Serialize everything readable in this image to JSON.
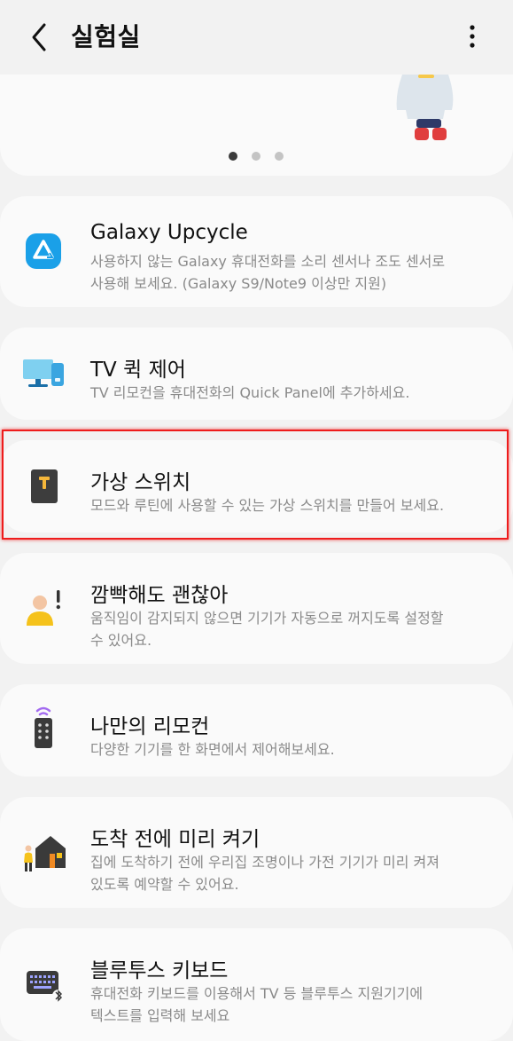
{
  "header": {
    "title": "실험실",
    "back_icon": "back-arrow-icon",
    "more_icon": "more-vertical-icon"
  },
  "banner": {
    "pager_active_index": 0,
    "pager_count": 3
  },
  "cards": [
    {
      "title": "Galaxy Upcycle",
      "desc": "사용하지 않는 Galaxy 휴대전화를 소리 센서나 조도 센서로\n사용해 보세요. (Galaxy S9/Note9 이상만 지원)",
      "icon": "upcycle-icon"
    },
    {
      "title": "TV 퀵 제어",
      "desc": "TV 리모컨을 휴대전화의 Quick Panel에 추가하세요.",
      "icon": "tv-icon"
    },
    {
      "title": "가상 스위치",
      "desc": "모드와 루틴에 사용할 수 있는 가상 스위치를 만들어 보세요.",
      "icon": "virtual-switch-icon"
    },
    {
      "title": "깜빡해도 괜찮아",
      "desc": "움직임이 감지되지 않으면 기기가 자동으로 꺼지도록 설정할\n수 있어요.",
      "icon": "person-alert-icon"
    },
    {
      "title": "나만의 리모컨",
      "desc": "다양한 기기를 한 화면에서 제어해보세요.",
      "icon": "remote-icon"
    },
    {
      "title": "도착 전에 미리 켜기",
      "desc": "집에 도착하기 전에 우리집 조명이나 가전 기기가 미리 켜져\n있도록 예약할 수 있어요.",
      "icon": "home-arrival-icon"
    },
    {
      "title": "블루투스 키보드",
      "desc": "휴대전화 키보드를 이용해서 TV 등 블루투스 지원기기에\n텍스트를 입력해 보세요",
      "icon": "bluetooth-keyboard-icon"
    }
  ],
  "colors": {
    "background": "#f2f2f2",
    "card": "#fafafa",
    "highlight": "#ee1c1c",
    "upcycle_blue": "#1aa0e8",
    "dot_active": "#3b3b3b",
    "dot_inactive": "#c4c4c4"
  }
}
